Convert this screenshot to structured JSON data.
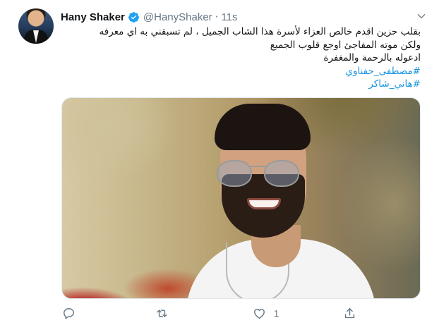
{
  "tweet": {
    "author_name": "Hany Shaker",
    "handle": "@HanyShaker",
    "separator": "·",
    "time": "11s",
    "text_lines": [
      "بقلب حزين اقدم خالص العزاء لأسرة هذا الشاب الجميل ، لم تسبقني به اي معرفه",
      "ولكن موته المفاجئ اوجع قلوب الجميع",
      "ادعوله بالرحمة والمغفرة"
    ],
    "hashtags": [
      "#مصطفى_حفناوي",
      "#هاني_شاكر"
    ]
  },
  "actions": {
    "reply_count": "",
    "retweet_count": "",
    "like_count": "1",
    "share_count": ""
  },
  "icons": {
    "verified": "verified-badge-icon",
    "more": "chevron-down-icon",
    "reply": "reply-icon",
    "retweet": "retweet-icon",
    "like": "heart-icon",
    "share": "share-icon"
  },
  "colors": {
    "accent": "#1da1f2",
    "link": "#1b95e0",
    "text": "#14171a",
    "secondary": "#657786"
  }
}
